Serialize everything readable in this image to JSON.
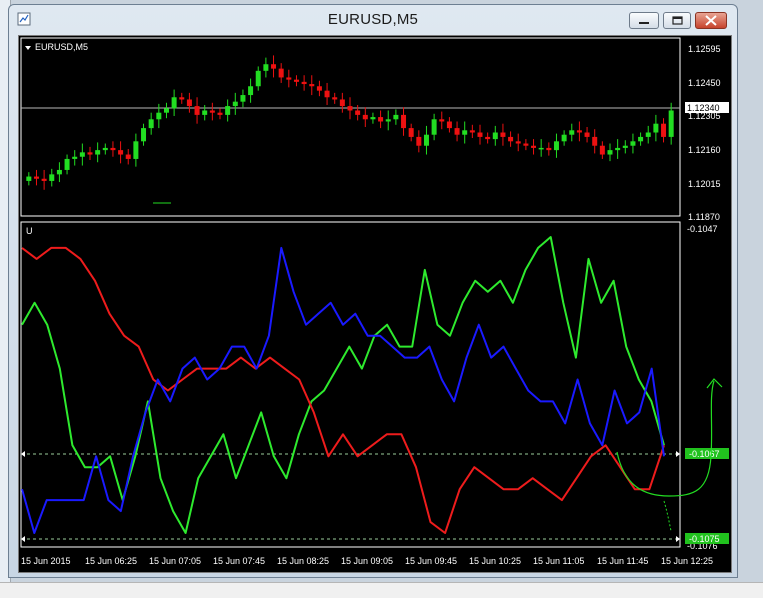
{
  "window": {
    "title": "EURUSD,M5"
  },
  "main_panel": {
    "label": "EURUSD,M5",
    "price_ticks": [
      "1.12595",
      "1.12450",
      "1.12305",
      "1.12160",
      "1.12015",
      "1.11870"
    ],
    "current_price": "1.12340"
  },
  "indicator_panel": {
    "label": "U",
    "top_value": "-0.1047",
    "bottom_value": "-0.1076",
    "marker_1": "-0.1067",
    "marker_2": "-0.1075"
  },
  "time_axis": [
    "15 Jun 2015",
    "15 Jun 06:25",
    "15 Jun 07:05",
    "15 Jun 07:45",
    "15 Jun 08:25",
    "15 Jun 09:05",
    "15 Jun 09:45",
    "15 Jun 10:25",
    "15 Jun 11:05",
    "15 Jun 11:45",
    "15 Jun 12:25"
  ],
  "colors": {
    "bull": "#22dd22",
    "bear": "#ee1111",
    "green_line": "#2eea2e",
    "red_line": "#ee1c1c",
    "blue_line": "#1a1aff",
    "marker_bg": "#21c21e"
  },
  "chart_data": [
    {
      "type": "candlestick",
      "title": "EURUSD,M5",
      "ylim": [
        1.1187,
        1.1266
      ],
      "close_series": [
        1.1204,
        1.1203,
        1.1202,
        1.1205,
        1.1207,
        1.1212,
        1.1213,
        1.1215,
        1.1214,
        1.1216,
        1.1217,
        1.1216,
        1.1214,
        1.1212,
        1.122,
        1.1226,
        1.123,
        1.1233,
        1.1235,
        1.124,
        1.1239,
        1.1236,
        1.1232,
        1.1234,
        1.1233,
        1.1232,
        1.1236,
        1.1238,
        1.1241,
        1.1245,
        1.1252,
        1.1255,
        1.1253,
        1.1249,
        1.1248,
        1.1247,
        1.1246,
        1.1245,
        1.1243,
        1.124,
        1.1239,
        1.1236,
        1.1234,
        1.1232,
        1.123,
        1.1231,
        1.1229,
        1.123,
        1.1232,
        1.1226,
        1.1222,
        1.1218,
        1.1223,
        1.123,
        1.1229,
        1.1226,
        1.1223,
        1.1225,
        1.1224,
        1.1222,
        1.1221,
        1.1224,
        1.1222,
        1.122,
        1.1219,
        1.1218,
        1.1217,
        1.1217,
        1.1216,
        1.122,
        1.1223,
        1.1225,
        1.1224,
        1.1222,
        1.1218,
        1.1214,
        1.1216,
        1.1217,
        1.1218,
        1.122,
        1.1222,
        1.1224,
        1.1228,
        1.1222,
        1.1234
      ],
      "current_price": 1.1234
    },
    {
      "type": "line",
      "title": "U",
      "ylim": [
        -0.1076,
        -0.1047
      ],
      "series": [
        {
          "color": "green",
          "values": [
            -0.1056,
            -0.1054,
            -0.1056,
            -0.106,
            -0.1067,
            -0.1069,
            -0.1069,
            -0.1068,
            -0.1072,
            -0.1068,
            -0.1063,
            -0.107,
            -0.1073,
            -0.1075,
            -0.107,
            -0.1068,
            -0.1066,
            -0.107,
            -0.1067,
            -0.1064,
            -0.1068,
            -0.107,
            -0.1066,
            -0.1063,
            -0.1062,
            -0.106,
            -0.1058,
            -0.106,
            -0.1057,
            -0.1056,
            -0.1058,
            -0.1058,
            -0.1051,
            -0.1056,
            -0.1057,
            -0.1054,
            -0.1052,
            -0.1053,
            -0.1052,
            -0.1054,
            -0.1051,
            -0.1049,
            -0.1048,
            -0.1054,
            -0.1059,
            -0.105,
            -0.1054,
            -0.1052,
            -0.1058,
            -0.1061,
            -0.1063,
            -0.1067
          ]
        },
        {
          "color": "red",
          "values": [
            -0.1049,
            -0.105,
            -0.1049,
            -0.1049,
            -0.105,
            -0.1052,
            -0.1055,
            -0.1057,
            -0.1058,
            -0.1061,
            -0.1062,
            -0.1061,
            -0.106,
            -0.106,
            -0.106,
            -0.1059,
            -0.106,
            -0.1059,
            -0.106,
            -0.1061,
            -0.1064,
            -0.1068,
            -0.1066,
            -0.1068,
            -0.1067,
            -0.1066,
            -0.1066,
            -0.1069,
            -0.1074,
            -0.1075,
            -0.1071,
            -0.1069,
            -0.107,
            -0.1071,
            -0.1071,
            -0.107,
            -0.1071,
            -0.1072,
            -0.107,
            -0.1068,
            -0.1067,
            -0.1069,
            -0.1071,
            -0.1071,
            -0.1067
          ]
        },
        {
          "color": "blue",
          "values": [
            -0.1071,
            -0.1075,
            -0.1072,
            -0.1072,
            -0.1072,
            -0.1072,
            -0.1068,
            -0.1072,
            -0.1073,
            -0.1068,
            -0.1064,
            -0.1061,
            -0.1063,
            -0.106,
            -0.1059,
            -0.1061,
            -0.106,
            -0.1058,
            -0.1058,
            -0.106,
            -0.1057,
            -0.1049,
            -0.1053,
            -0.1056,
            -0.1055,
            -0.1054,
            -0.1056,
            -0.1055,
            -0.1057,
            -0.1057,
            -0.1058,
            -0.1059,
            -0.1059,
            -0.1058,
            -0.1061,
            -0.1063,
            -0.1059,
            -0.1056,
            -0.1059,
            -0.1058,
            -0.106,
            -0.1062,
            -0.1063,
            -0.1063,
            -0.1065,
            -0.1061,
            -0.1065,
            -0.1067,
            -0.1062,
            -0.1065,
            -0.1064,
            -0.106,
            -0.1068
          ]
        }
      ],
      "reference_lines": [
        -0.1067,
        -0.1075
      ]
    }
  ]
}
